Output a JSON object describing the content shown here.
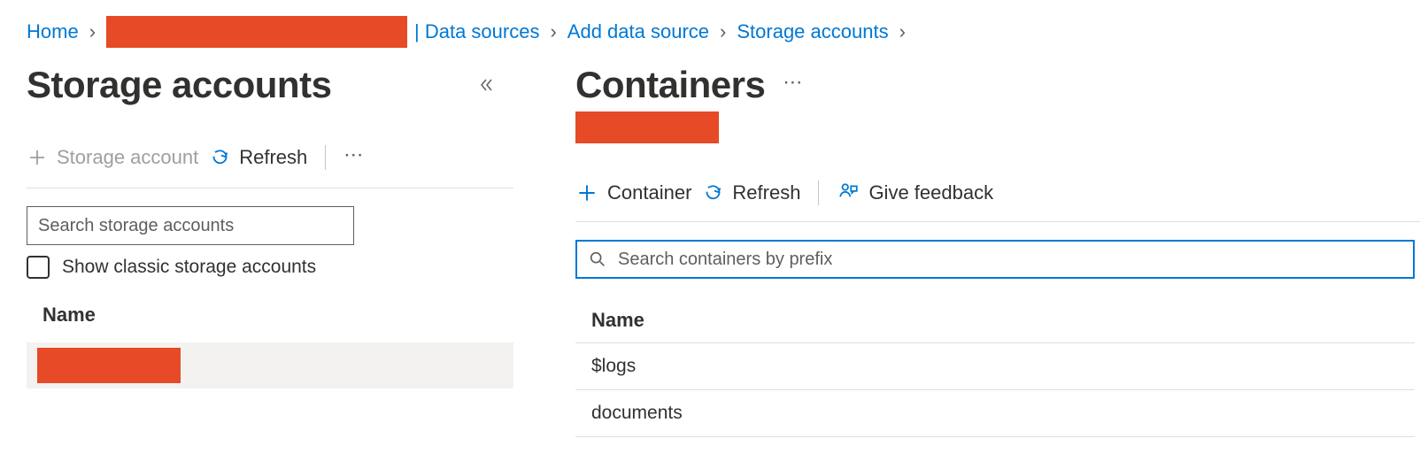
{
  "breadcrumb": {
    "home": "Home",
    "data_sources": "| Data sources",
    "add_data_source": "Add data source",
    "storage_accounts": "Storage accounts"
  },
  "left": {
    "title": "Storage accounts",
    "add_label": "Storage account",
    "refresh_label": "Refresh",
    "search_placeholder": "Search storage accounts",
    "checkbox_label": "Show classic storage accounts",
    "col_name": "Name"
  },
  "right": {
    "title": "Containers",
    "add_label": "Container",
    "refresh_label": "Refresh",
    "feedback_label": "Give feedback",
    "search_placeholder": "Search containers by prefix",
    "col_name": "Name",
    "items": [
      "$logs",
      "documents"
    ]
  }
}
